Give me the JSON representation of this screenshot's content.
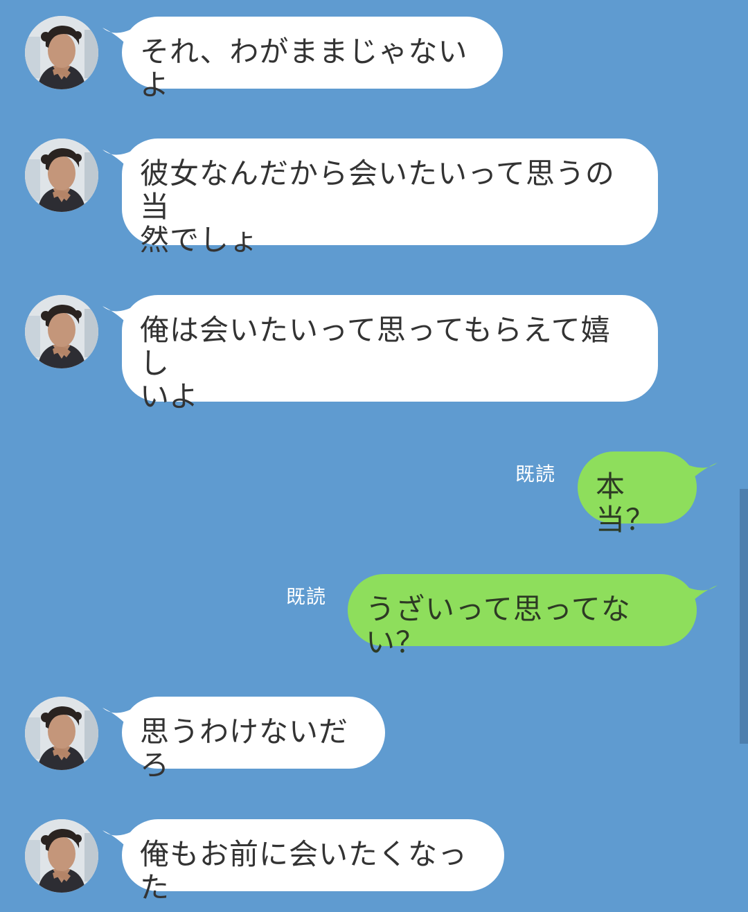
{
  "colors": {
    "background": "#5f9bd0",
    "incoming_bubble": "#ffffff",
    "outgoing_bubble": "#8ede5c",
    "read_text": "#ffffff"
  },
  "contact": {
    "avatar_icon": "profile-photo-icon"
  },
  "messages": [
    {
      "direction": "incoming",
      "lines": [
        "それ、わがままじゃないよ"
      ]
    },
    {
      "direction": "incoming",
      "lines": [
        "彼女なんだから会いたいって思うの当",
        "然でしょ"
      ]
    },
    {
      "direction": "incoming",
      "lines": [
        "俺は会いたいって思ってもらえて嬉し",
        "いよ"
      ]
    },
    {
      "direction": "outgoing",
      "read": "既読",
      "lines": [
        "本当？"
      ]
    },
    {
      "direction": "outgoing",
      "read": "既読",
      "lines": [
        "うざいって思ってない？"
      ]
    },
    {
      "direction": "incoming",
      "lines": [
        "思うわけないだろ"
      ]
    },
    {
      "direction": "incoming",
      "lines": [
        "俺もお前に会いたくなった"
      ]
    }
  ]
}
